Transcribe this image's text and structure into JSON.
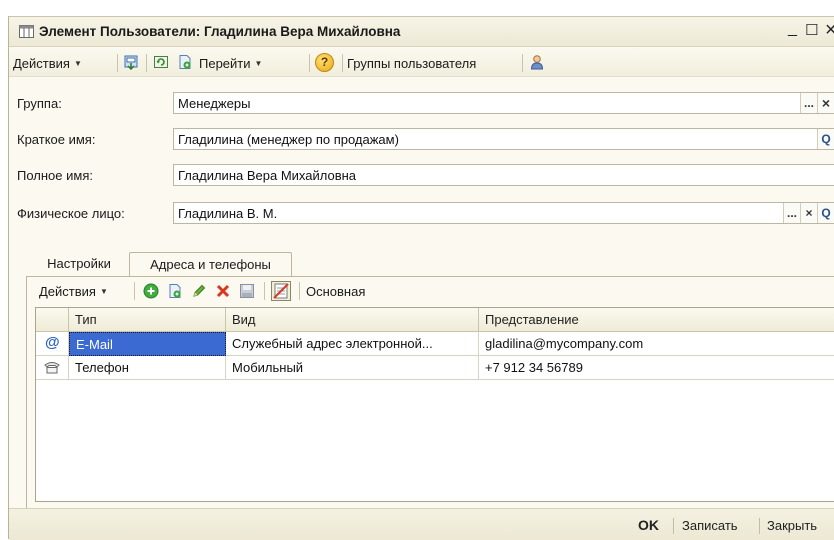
{
  "window": {
    "title": "Элемент Пользователи: Гладилина Вера Михайловна",
    "minimize": "_",
    "maximize": "☐",
    "close": "×"
  },
  "toolbar": {
    "actions": "Действия",
    "goto": "Перейти",
    "help": "?",
    "user_groups": "Группы пользователя",
    "icons": [
      "save-exit-icon",
      "refresh-icon",
      "copy-doc-icon",
      "help-icon",
      "user-icon"
    ]
  },
  "form": {
    "group": {
      "label": "Группа:",
      "value": "Менеджеры",
      "select": "...",
      "clear": "×"
    },
    "short_name": {
      "label": "Краткое имя:",
      "value": "Гладилина  (менеджер по продажам)",
      "search": "Q"
    },
    "full_name": {
      "label": "Полное имя:",
      "value": "Гладилина Вера Михайловна"
    },
    "person": {
      "label": "Физическое лицо:",
      "value": "Гладилина В. М.",
      "select": "...",
      "clear": "×",
      "search": "Q"
    }
  },
  "tabs": [
    {
      "label": "Настройки",
      "active": false
    },
    {
      "label": "Адреса и телефоны",
      "active": true
    }
  ],
  "grid_toolbar": {
    "actions": "Действия",
    "main": "Основная",
    "icons": [
      "add-icon",
      "copy-icon",
      "edit-icon",
      "delete-icon",
      "save-icon",
      "set-main-icon"
    ]
  },
  "grid": {
    "columns": [
      "Тип",
      "Вид",
      "Представление"
    ],
    "rows": [
      {
        "icon": "email-icon",
        "type": "E-Mail",
        "kind": "Служебный адрес электронной...",
        "value": "gladilina@mycompany.com"
      },
      {
        "icon": "phone-icon",
        "type": "Телефон",
        "kind": "Мобильный",
        "value": "+7 912 34 56789"
      }
    ]
  },
  "bottom": {
    "ok": "OK",
    "save": "Записать",
    "close": "Закрыть"
  },
  "colors": {
    "selection": "#3c6ad3",
    "window_bg": "#fbf9f0",
    "delete_red": "#cc2a1e"
  }
}
